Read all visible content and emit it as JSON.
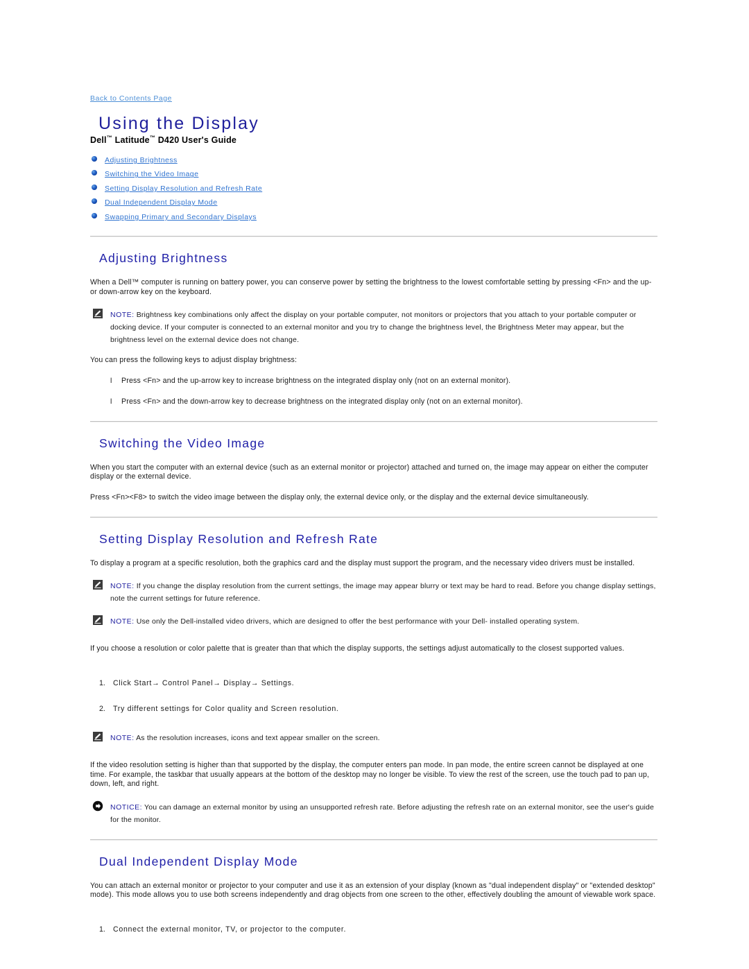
{
  "back_link": "Back to Contents Page",
  "title": "Using the Display",
  "subtitle_parts": {
    "dell": "Dell",
    "tm1": "™",
    "latitude": " Latitude",
    "tm2": "™",
    "model": " D420 User's Guide"
  },
  "subtitle_full": "Dell™ Latitude™ D420 User's Guide",
  "toc": [
    {
      "label": "Adjusting Brightness"
    },
    {
      "label": "Switching the Video Image"
    },
    {
      "label": "Setting Display Resolution and Refresh Rate"
    },
    {
      "label": "Dual Independent Display Mode"
    },
    {
      "label": "Swapping Primary and Secondary Displays"
    }
  ],
  "sections": {
    "brightness": {
      "heading": "Adjusting Brightness",
      "intro": "When a Dell™ computer is running on battery power, you can conserve power by setting the brightness to the lowest comfortable setting by pressing <Fn> and the up- or down-arrow key on the keyboard.",
      "note_label": "NOTE:",
      "note_text": " Brightness key combinations only affect the display on your portable computer, not monitors or projectors that you attach to your portable computer or docking device. If your computer is connected to an external monitor and you try to change the brightness level, the Brightness Meter may appear, but the brightness level on the external device does not change.",
      "keys_intro": "You can press the following keys to adjust display brightness:",
      "keys": [
        "Press <Fn> and the up-arrow key to increase brightness on the integrated display only (not on an external monitor).",
        "Press <Fn> and the down-arrow key to decrease brightness on the integrated display only (not on an external monitor)."
      ]
    },
    "switching": {
      "heading": "Switching the Video Image",
      "para1": "When you start the computer with an external device (such as an external monitor or projector) attached and turned on, the image may appear on either the computer display or the external device.",
      "para2": "Press <Fn><F8> to switch the video image between the display only, the external device only, or the display and the external device simultaneously."
    },
    "resolution": {
      "heading": "Setting Display Resolution and Refresh Rate",
      "intro": "To display a program at a specific resolution, both the graphics card and the display must support the program, and the necessary video drivers must be installed.",
      "note1_label": "NOTE:",
      "note1_text": " If you change the display resolution from the current settings, the image may appear blurry or text may be hard to read. Before you change display settings, note the current settings for future reference.",
      "note2_label": "NOTE:",
      "note2_text": " Use only the Dell-installed video drivers, which are designed to offer the best performance with your Dell- installed operating system.",
      "palette_para": "If you choose a resolution or color palette that is greater than that which the display supports, the settings adjust automatically to the closest supported values.",
      "steps": [
        {
          "num": "1.",
          "text": "Click Start→ Control Panel→ Display→ Settings."
        },
        {
          "num": "2.",
          "text": "Try different settings for Color quality and Screen resolution."
        }
      ],
      "note3_label": "NOTE:",
      "note3_text": " As the resolution increases, icons and text appear smaller on the screen.",
      "pan_para": "If the video resolution setting is higher than that supported by the display, the computer enters pan mode. In pan mode, the entire screen cannot be displayed at one time. For example, the taskbar that usually appears at the bottom of the desktop may no longer be visible. To view the rest of the screen, use the touch pad to pan up, down, left, and right.",
      "notice_label": "NOTICE:",
      "notice_text": " You can damage an external monitor by using an unsupported refresh rate. Before adjusting the refresh rate on an external monitor, see the user's guide for the monitor."
    },
    "dual": {
      "heading": "Dual Independent Display Mode",
      "para1": "You can attach an external monitor or projector to your computer and use it as an extension of your display (known as \"dual independent display\" or \"extended desktop\" mode). This mode allows you to use both screens independently and drag objects from one screen to the other, effectively doubling the amount of viewable work space.",
      "steps": [
        {
          "num": "1.",
          "text": "Connect the external monitor, TV, or projector to the computer."
        }
      ]
    }
  },
  "colors": {
    "title_blue": "#1f1f9c",
    "heading_blue": "#2020a8",
    "link_blue": "#2f73d0",
    "backlink_blue": "#4d8fd6",
    "keyword_blue": "#2222a0",
    "rule_gray": "#bfbfbf"
  },
  "icons": {
    "note": "note-pencil-icon",
    "notice": "notice-arrow-icon",
    "bullet": "bullet-dot-icon"
  }
}
